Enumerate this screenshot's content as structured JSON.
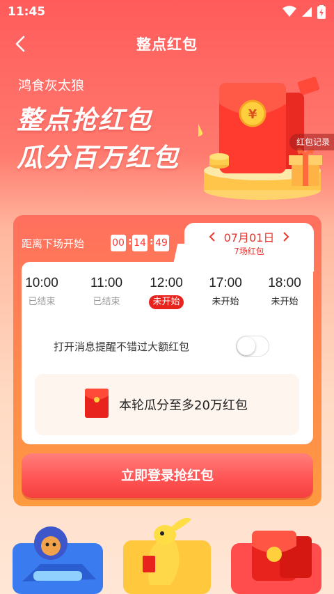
{
  "status_bar": {
    "time": "11:45",
    "icons": [
      "wifi-icon",
      "signal-icon",
      "battery-icon"
    ]
  },
  "nav": {
    "title": "整点红包",
    "back_icon": "chevron-left-icon"
  },
  "hero": {
    "brand": "鸿食灰太狼",
    "headline_1": "整点抢红包",
    "headline_2": "瓜分百万红包",
    "record_link": "红包记录"
  },
  "countdown": {
    "label": "距离下场开始",
    "hours": "00",
    "minutes": "14",
    "seconds": "49"
  },
  "date_selector": {
    "date": "07月01日",
    "sessions": "7场红包"
  },
  "sessions": [
    {
      "time": "10:00",
      "status": "已结束",
      "state": "ended"
    },
    {
      "time": "11:00",
      "status": "已结束",
      "state": "ended"
    },
    {
      "time": "12:00",
      "status": "未开始",
      "state": "active"
    },
    {
      "time": "17:00",
      "status": "未开始",
      "state": "upcoming"
    },
    {
      "time": "18:00",
      "status": "未开始",
      "state": "upcoming"
    }
  ],
  "reminder": {
    "label": "打开消息提醒不错过大额红包",
    "enabled": false
  },
  "prize": {
    "text": "本轮瓜分至多20万红包"
  },
  "login_button": {
    "label": "立即登录抢红包"
  },
  "colors": {
    "primary_red": "#e8221c",
    "accent": "#ff5b5b",
    "orange": "#ff9a3f"
  }
}
